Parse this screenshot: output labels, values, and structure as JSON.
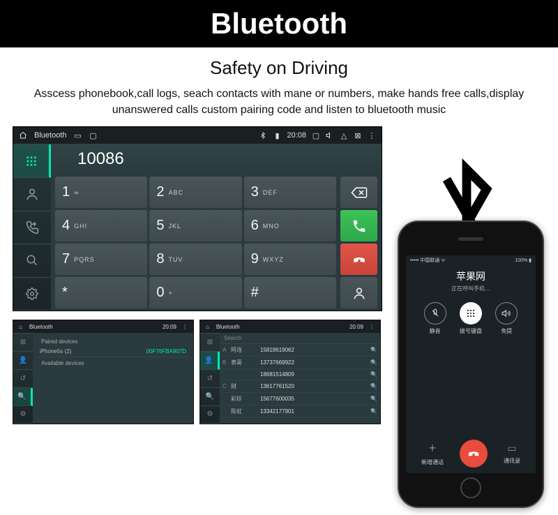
{
  "header": {
    "title": "Bluetooth",
    "subtitle": "Safety on Driving"
  },
  "description": "Asscess phonebook,call logs, seach contacts with mane or numbers, make hands free calls,display unanswered calls custom pairing code and listen to bluetooth music",
  "statusbar": {
    "label": "Bluetooth",
    "time": "20:08",
    "time2": "20:09",
    "time3": "20:09"
  },
  "dialer": {
    "display": "10086"
  },
  "keys": [
    {
      "num": "1",
      "letters": "∞"
    },
    {
      "num": "2",
      "letters": "ABC"
    },
    {
      "num": "3",
      "letters": "DEF"
    },
    {
      "num": "4",
      "letters": "GHI"
    },
    {
      "num": "5",
      "letters": "JKL"
    },
    {
      "num": "6",
      "letters": "MNO"
    },
    {
      "num": "7",
      "letters": "PQRS"
    },
    {
      "num": "8",
      "letters": "TUV"
    },
    {
      "num": "9",
      "letters": "WXYZ"
    },
    {
      "num": "*",
      "letters": ""
    },
    {
      "num": "0",
      "letters": "+"
    },
    {
      "num": "#",
      "letters": ""
    }
  ],
  "paired": {
    "header": "Paired devices",
    "device": "iPhone5s (2)",
    "mac": "00F76FBA907D",
    "available": "Available devices"
  },
  "contacts": {
    "search": "Search",
    "items": [
      {
        "letter": "A",
        "name": "阿连",
        "number": "15818619062"
      },
      {
        "letter": "B",
        "name": "表哥",
        "number": "13737669922"
      },
      {
        "letter": "",
        "name": "",
        "number": "18681514809"
      },
      {
        "letter": "C",
        "name": "财",
        "number": "13617761520"
      },
      {
        "letter": "",
        "name": "彩珍",
        "number": "15677600035"
      },
      {
        "letter": "",
        "name": "陈虹",
        "number": "13342177901"
      }
    ]
  },
  "phone": {
    "carrier": "中国联通",
    "batt": "100%",
    "name": "苹果网",
    "status": "正在呼叫手机…",
    "buttons": {
      "mute": "静音",
      "keypad": "拨号键盘",
      "speaker": "免提",
      "addcall": "新增通话",
      "contacts": "通讯录"
    }
  }
}
